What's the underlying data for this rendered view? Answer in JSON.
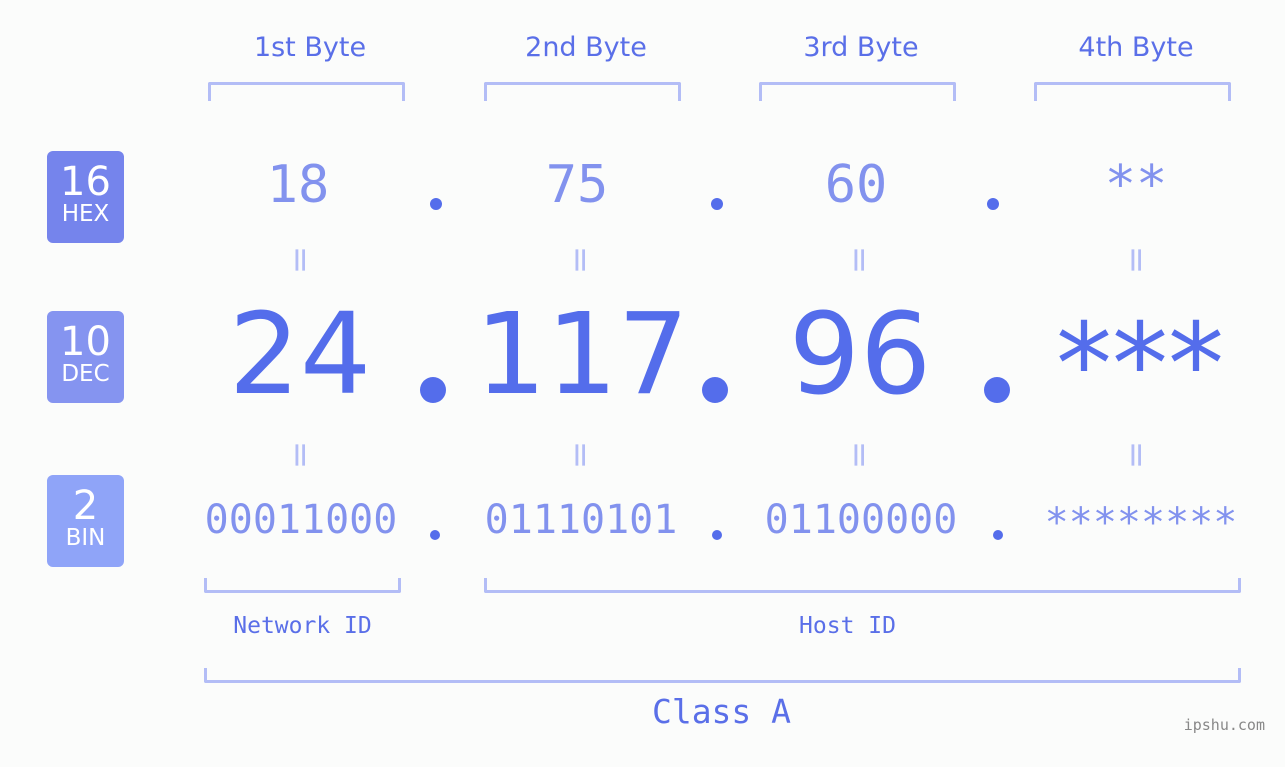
{
  "bytes": [
    {
      "label": "1st Byte",
      "hex": "18",
      "dec": "24",
      "bin": "00011000"
    },
    {
      "label": "2nd Byte",
      "hex": "75",
      "dec": "117",
      "bin": "01110101"
    },
    {
      "label": "3rd Byte",
      "hex": "60",
      "dec": "96",
      "bin": "01100000"
    },
    {
      "label": "4th Byte",
      "hex": "**",
      "dec": "***",
      "bin": "********"
    }
  ],
  "badges": {
    "hex": {
      "num": "16",
      "unit": "HEX",
      "color": "#7584ec"
    },
    "dec": {
      "num": "10",
      "unit": "DEC",
      "color": "#8594f0"
    },
    "bin": {
      "num": "2",
      "unit": "BIN",
      "color": "#8fa4f8"
    }
  },
  "equals": "=",
  "segments": {
    "network": "Network ID",
    "host": "Host ID"
  },
  "class_label": "Class A",
  "watermark": "ipshu.com",
  "colors": {
    "accent": "#546deb",
    "light": "#8292ee",
    "bracket": "#b3bdf6"
  }
}
